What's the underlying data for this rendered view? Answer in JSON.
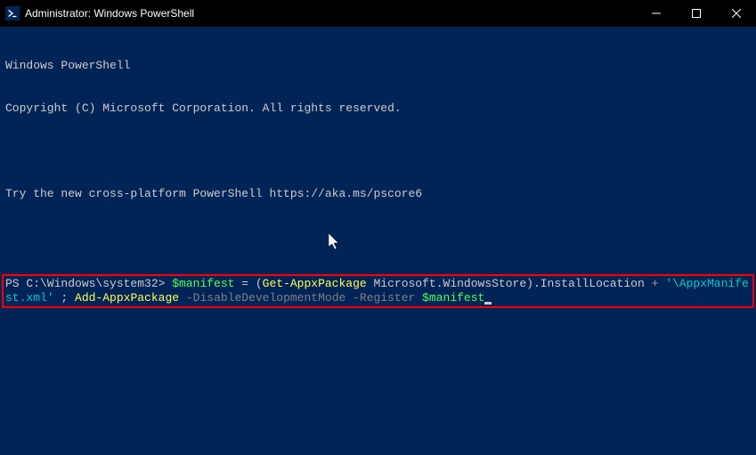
{
  "window": {
    "title": "Administrator: Windows PowerShell"
  },
  "header": {
    "line1": "Windows PowerShell",
    "line2": "Copyright (C) Microsoft Corporation. All rights reserved.",
    "line3": "Try the new cross-platform PowerShell https://aka.ms/pscore6"
  },
  "command": {
    "prompt": "PS C:\\Windows\\system32> ",
    "var1": "$manifest",
    "eq": " = (",
    "cmdlet1": "Get-AppxPackage",
    "arg1": " Microsoft.WindowsStore",
    "close_paren": ").InstallLocation ",
    "plus": "+",
    "string1": " '\\AppxManifest.xml' ",
    "semi": "; ",
    "cmdlet2": "Add-AppxPackage",
    "param1": " -DisableDevelopmentMode -Register ",
    "var2": "$manifest"
  }
}
